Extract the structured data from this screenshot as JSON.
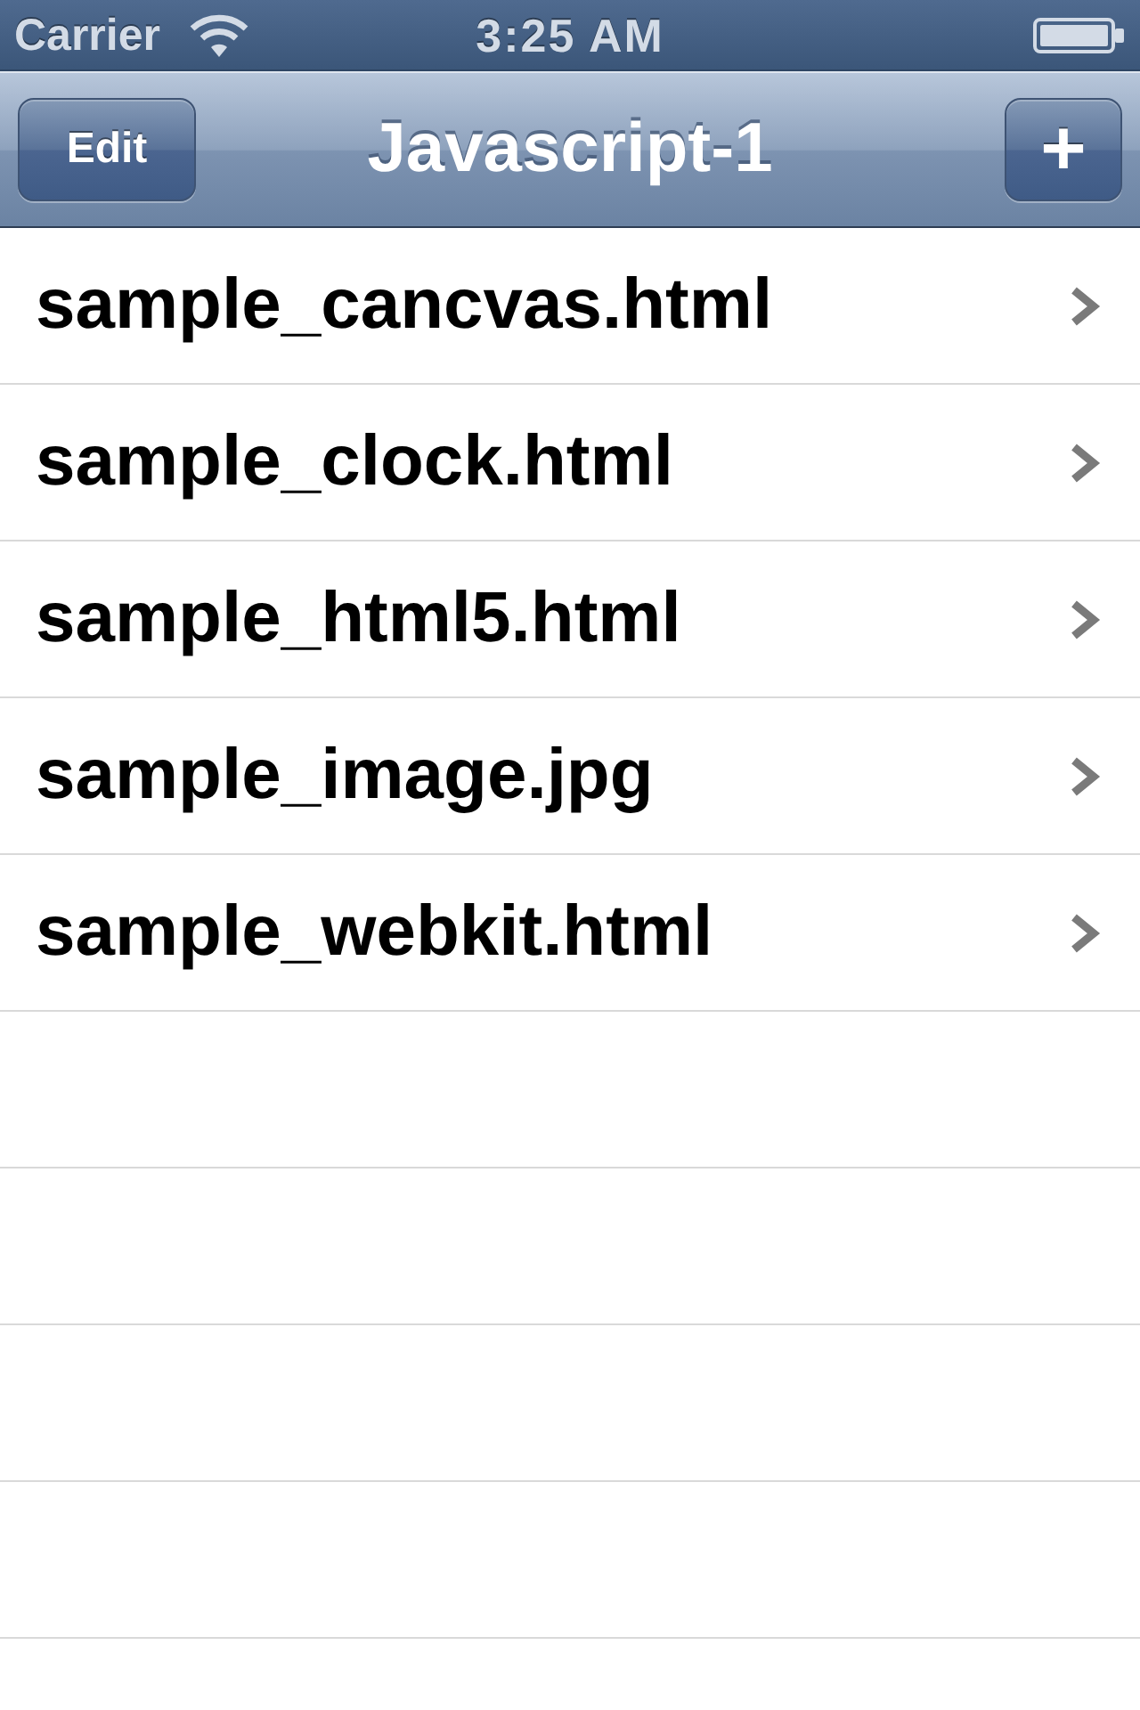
{
  "status_bar": {
    "carrier": "Carrier",
    "time": "3:25 AM"
  },
  "nav_bar": {
    "title": "Javascript-1",
    "left_button": "Edit",
    "right_button": "+"
  },
  "files": [
    {
      "name": "sample_cancvas.html"
    },
    {
      "name": "sample_clock.html"
    },
    {
      "name": "sample_html5.html"
    },
    {
      "name": "sample_image.jpg"
    },
    {
      "name": "sample_webkit.html"
    }
  ]
}
